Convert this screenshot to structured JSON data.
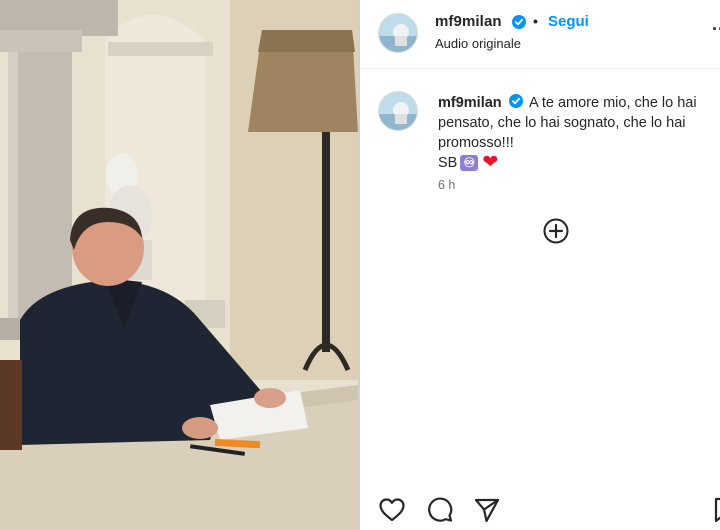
{
  "header": {
    "username": "mf9milan",
    "separator": "•",
    "follow_label": "Segui",
    "audio_label": "Audio originale",
    "more_label": "..."
  },
  "caption": {
    "username": "mf9milan",
    "line1": "A te amore mio, che lo hai",
    "line2": "pensato, che lo hai sognato, che lo hai",
    "line3": "promosso!!!",
    "signature_text": "SB",
    "infinity_glyph": "♾",
    "heart_glyph": "❤"
  },
  "timestamp": "6 h",
  "icons": {
    "add": "plus-circle-icon",
    "like": "heart-icon",
    "comment": "comment-icon",
    "share": "share-icon",
    "save": "bookmark-icon"
  },
  "colors": {
    "follow_blue": "#0095f6",
    "verified_blue": "#0095f6",
    "heart_red": "#e8132c",
    "infinity_box": "#8e7dd6"
  }
}
